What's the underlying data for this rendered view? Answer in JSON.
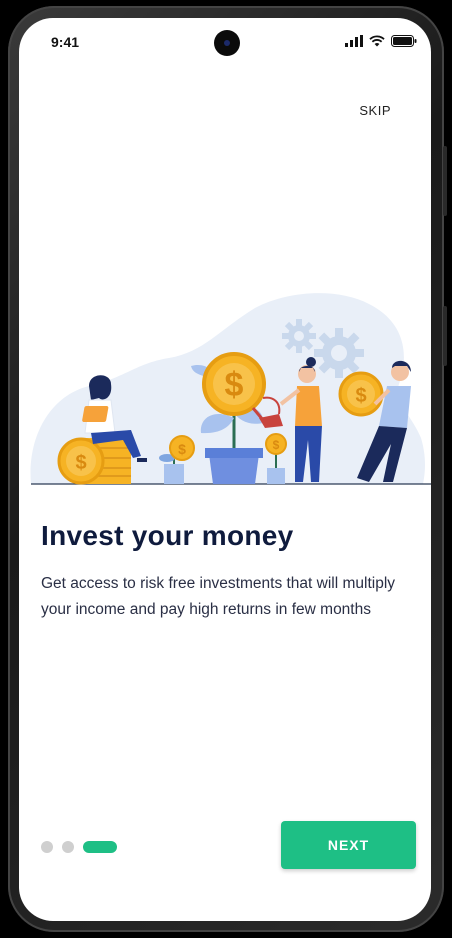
{
  "status_bar": {
    "time": "9:41"
  },
  "onboarding": {
    "skip_label": "SKIP",
    "title": "Invest your money",
    "description": "Get access to risk free investments that will multiply your income and pay high returns in few months",
    "next_label": "NEXT",
    "page_indicator": {
      "total": 3,
      "current": 3
    }
  },
  "colors": {
    "accent": "#1ebf85",
    "title": "#0f1b3d",
    "coin": "#f6b324"
  }
}
